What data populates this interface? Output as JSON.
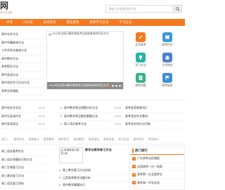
{
  "theme": {
    "accent": "#f47920"
  },
  "header": {
    "logo": "网",
    "slogan": "学习方法网",
    "search_placeholder": "请输入你要查找的内容"
  },
  "nav": [
    "中考",
    "小升初",
    "高考资讯",
    "职业教育",
    "教师学习方法",
    "学习方法"
  ],
  "left_menu": [
    "高中化学方法",
    "高中学籍查询方法",
    "小升初考试查询方法",
    "高中数学方法",
    "高考报名方法",
    "高中英语方法",
    "高中语文学习方法大全",
    "高考志愿填报"
  ],
  "slider": {
    "image_alt": "2015年全国计算机等级考试成绩查询时间及方式",
    "caption": "2015年全国计算机等级考试成绩查询时间及方式"
  },
  "quick_links": [
    {
      "label": "北京高考",
      "icon": "pencil-icon",
      "color": "#f47920"
    },
    {
      "label": "高考作文",
      "icon": "book-icon",
      "color": "#3a9ad9"
    },
    {
      "label": "学习方法",
      "icon": "bulb-icon",
      "color": "#2bb3a3"
    },
    {
      "label": "大学排名",
      "icon": "school-icon",
      "color": "#4f7fd3"
    },
    {
      "label": "高考试题",
      "icon": "document-icon",
      "color": "#32b28a"
    },
    {
      "label": "高考志愿",
      "icon": "flag-icon",
      "color": "#3f8ed6"
    }
  ],
  "news_columns": [
    [
      {
        "title": "高中语文文言文",
        "date": "09-26"
      },
      {
        "title": "高中生英语作文",
        "date": "09-26"
      },
      {
        "title": "高中英语语法",
        "date": "09-25"
      }
    ],
    [
      {
        "title": "高中数学常见错题分析方法",
        "date": "09-30"
      },
      {
        "title": "高中数学常见题型解题方法",
        "date": "09-30"
      },
      {
        "title": "高二语文备考方法",
        "date": "09-29"
      }
    ],
    [
      {
        "title": "高考英语高频词汇"
      },
      {
        "title": "高考语文作文素材"
      },
      {
        "title": "高考语文知识点归纳"
      }
    ]
  ],
  "tags": {
    "label": "热门：",
    "items": [
      "高考作文",
      "高考复习",
      "高考数学",
      "高中学习",
      "高中数学",
      "高考语文",
      "高考英语",
      "学习方法",
      "高中作文",
      "考试技巧"
    ]
  },
  "bottom_left": [
    "高三语文备考作文",
    "高三语文答题技巧和方法",
    "高三生物复习方法",
    "高三政治复习方法",
    "高三语文复习资料"
  ],
  "bottom_middle": {
    "image_alt": "新课程高中数学分析",
    "title": "数学与数学练习方法",
    "items": [
      "高三数学复习方法总结",
      "江西高考数学试题分析",
      "高中数学解题技巧"
    ]
  },
  "rank": {
    "title": "热门排行",
    "items": [
      {
        "no": "1",
        "title": "广东高考志愿填报"
      },
      {
        "no": "2",
        "title": "全国高考一分一段表"
      },
      {
        "no": "3",
        "title": "高考第一天全国考生"
      },
      {
        "no": "4",
        "title": "高考高一开学必读"
      }
    ]
  }
}
